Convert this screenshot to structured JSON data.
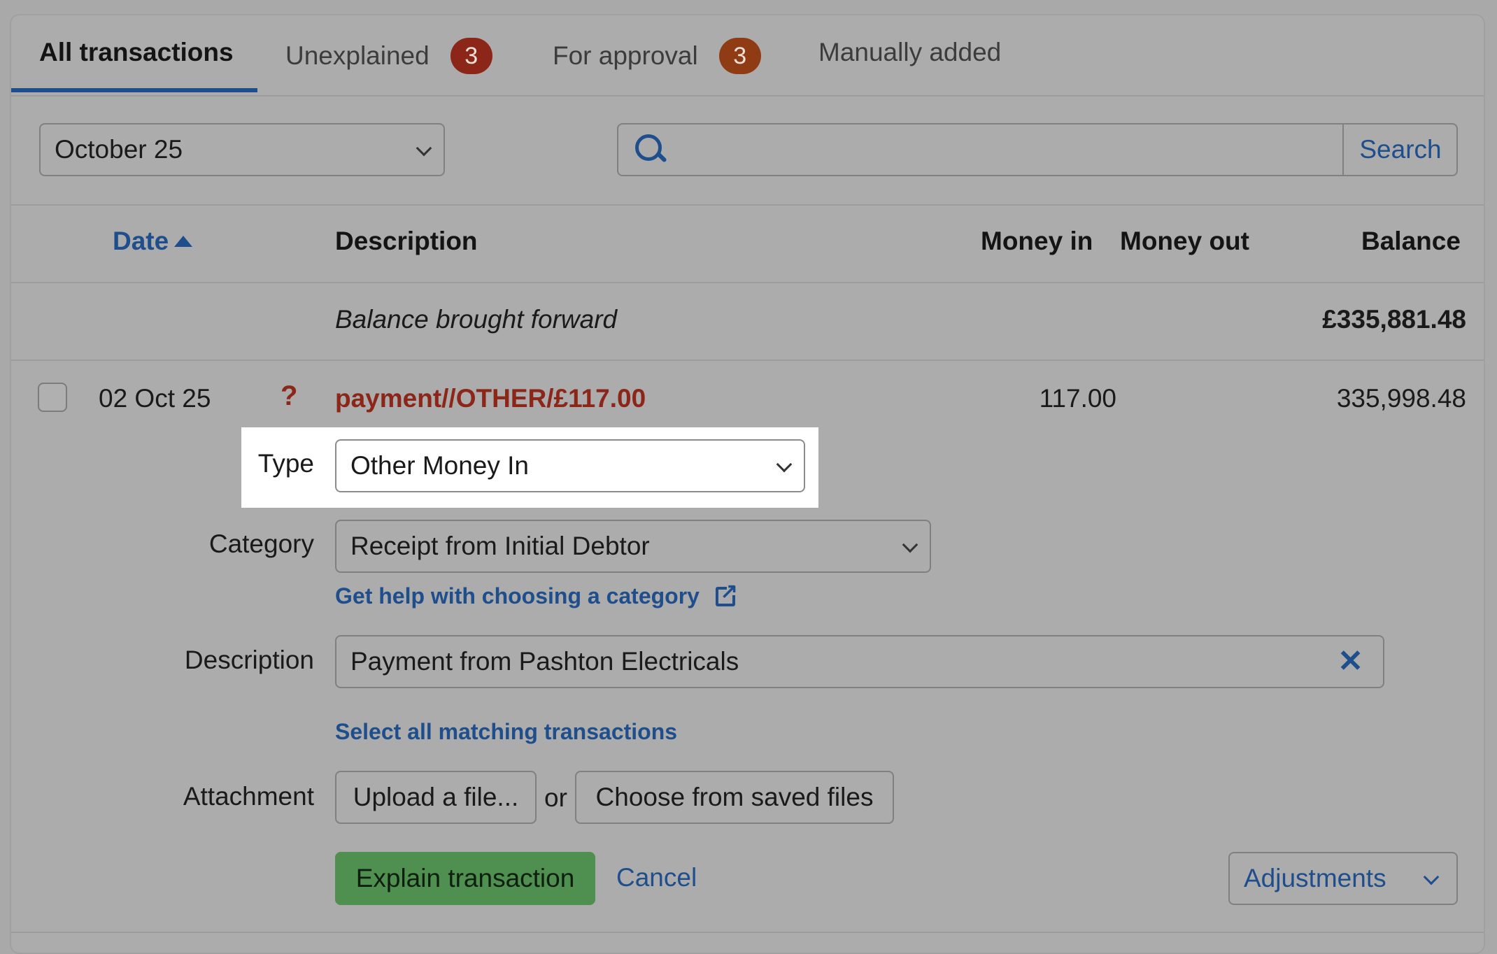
{
  "tabs": [
    {
      "label": "All transactions"
    },
    {
      "label": "Unexplained",
      "badge": "3"
    },
    {
      "label": "For approval",
      "badge": "3"
    },
    {
      "label": "Manually added"
    }
  ],
  "filters": {
    "period_value": "October 25",
    "search_value": "",
    "search_button": "Search"
  },
  "table": {
    "headers": {
      "date": "Date",
      "description": "Description",
      "money_in": "Money in",
      "money_out": "Money out",
      "balance": "Balance"
    },
    "brought_forward": {
      "label": "Balance brought forward",
      "balance": "£335,881.48"
    },
    "row": {
      "date": "02 Oct 25",
      "status_mark": "?",
      "description": "payment//OTHER/£117.00",
      "money_in": "117.00",
      "balance": "335,998.48"
    }
  },
  "form": {
    "type_label": "Type",
    "type_value": "Other Money In",
    "category_label": "Category",
    "category_value": "Receipt from Initial Debtor",
    "category_help_link": "Get help with choosing a category",
    "description_label": "Description",
    "description_value": "Payment from Pashton Electricals",
    "select_matching_link": "Select all matching transactions",
    "attachment_label": "Attachment",
    "upload_button": "Upload a file...",
    "or_text": "or",
    "saved_files_button": "Choose from saved files",
    "explain_button": "Explain transaction",
    "cancel_link": "Cancel",
    "adjustments_button": "Adjustments"
  },
  "colors": {
    "accent": "#1f4e8c",
    "alert_red": "#8c2619",
    "badge_orange": "#8f3c15",
    "explain_green": "#4f8f4f"
  }
}
